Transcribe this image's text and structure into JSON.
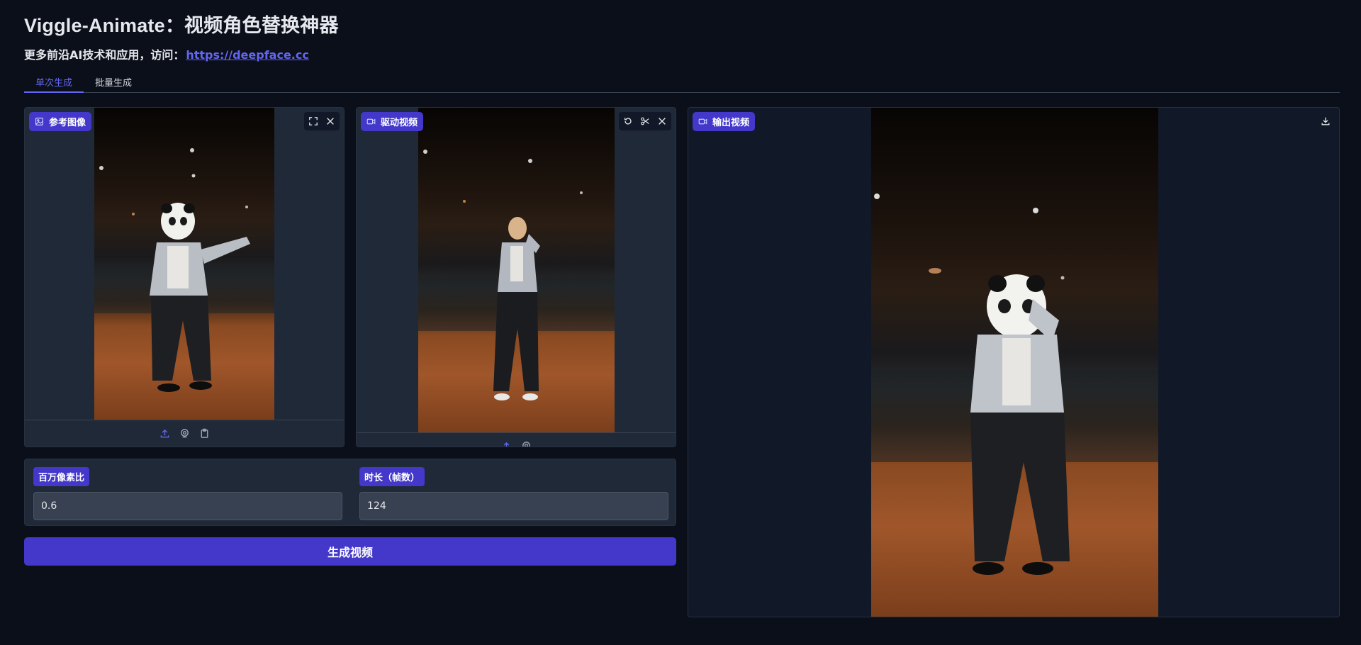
{
  "header": {
    "title": "Viggle-Animate：视频角色替换神器",
    "subtitle_prefix": "更多前沿AI技术和应用，访问：",
    "subtitle_link": "https://deepface.cc"
  },
  "tabs": [
    {
      "label": "单次生成",
      "active": true
    },
    {
      "label": "批量生成",
      "active": false
    }
  ],
  "reference_image": {
    "label": "参考图像",
    "tools": [
      "fullscreen-icon",
      "close-icon"
    ],
    "bottom_tools": [
      "upload-icon",
      "webcam-icon",
      "clipboard-icon"
    ]
  },
  "driving_video": {
    "label": "驱动视频",
    "tools": [
      "undo-icon",
      "scissors-icon",
      "close-icon"
    ],
    "bottom_tools": [
      "upload-icon",
      "webcam-icon"
    ]
  },
  "output_video": {
    "label": "输出视频",
    "tools": [
      "download-icon"
    ]
  },
  "params": {
    "megapixels": {
      "label": "百万像素比",
      "value": "0.6"
    },
    "frames": {
      "label": "时长（帧数）",
      "value": "124"
    }
  },
  "generate_button": "生成视频",
  "colors": {
    "background": "#0b0f19",
    "panel": "#1f2937",
    "accent": "#4338ca",
    "link": "#6366f1"
  }
}
